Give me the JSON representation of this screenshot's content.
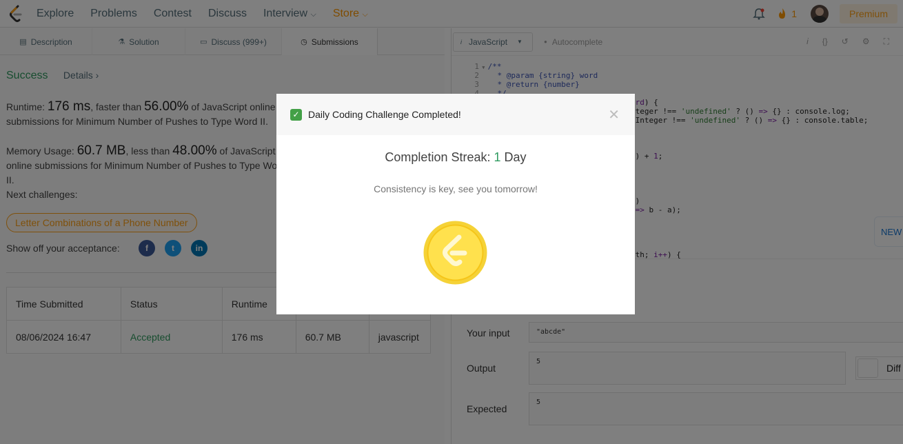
{
  "nav": {
    "links": [
      "Explore",
      "Problems",
      "Contest",
      "Discuss",
      "Interview",
      "Store"
    ],
    "streak_count": "1",
    "premium": "Premium"
  },
  "left": {
    "tabs": [
      "Description",
      "Solution",
      "Discuss (999+)",
      "Submissions"
    ],
    "result": {
      "status": "Success",
      "details": "Details"
    },
    "runtime": {
      "label": "Runtime:",
      "value": "176 ms",
      "faster_text": ", faster than",
      "pct": "56.00%",
      "tail": "of JavaScript online submissions for Minimum Number of Pushes to Type Word II."
    },
    "memory": {
      "label": "Memory Usage:",
      "value": "60.7 MB",
      "less_text": ", less than",
      "pct": "48.00%",
      "tail": "of JavaScript online submissions for Minimum Number of Pushes to Type Word II."
    },
    "next_label": "Next challenges:",
    "next_challenge": "Letter Combinations of a Phone Number",
    "share_label": "Show off your acceptance:",
    "table": {
      "headers": [
        "Time Submitted",
        "Status",
        "Runtime",
        "Memory",
        "Language"
      ],
      "row": [
        "08/06/2024 16:47",
        "Accepted",
        "176 ms",
        "60.7 MB",
        "javascript"
      ]
    }
  },
  "right": {
    "language": "JavaScript",
    "autocomplete": "Autocomplete",
    "code_lines": [
      {
        "n": "1",
        "t": "/**"
      },
      {
        "n": "2",
        "t": " * @param {string} word"
      },
      {
        "n": "3",
        "t": " * @return {number}"
      },
      {
        "n": "4",
        "t": " */"
      }
    ],
    "your_input_label": "Your input",
    "your_input": "\"abcde\"",
    "output_label": "Output",
    "output": "5",
    "expected_label": "Expected",
    "expected": "5",
    "diff": "Diff",
    "new_tag": "NEW"
  },
  "modal": {
    "title": "Daily Coding Challenge Completed!",
    "streak_prefix": "Completion Streak:",
    "streak_num": "1",
    "streak_suffix": "Day",
    "message": "Consistency is key, see you tomorrow!"
  }
}
